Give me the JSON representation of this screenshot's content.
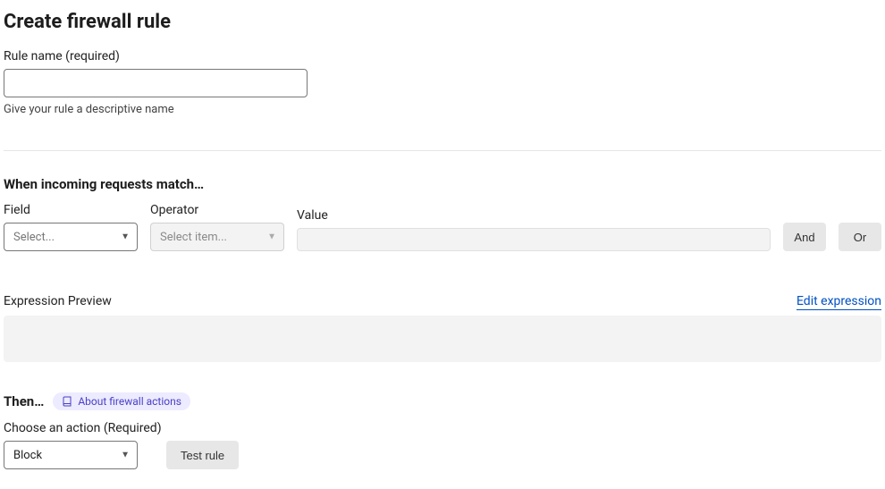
{
  "heading": "Create firewall rule",
  "rule_name": {
    "label": "Rule name (required)",
    "value": "",
    "help": "Give your rule a descriptive name"
  },
  "match": {
    "heading": "When incoming requests match…",
    "field": {
      "label": "Field",
      "placeholder": "Select..."
    },
    "operator": {
      "label": "Operator",
      "placeholder": "Select item..."
    },
    "value": {
      "label": "Value",
      "value": ""
    },
    "and_label": "And",
    "or_label": "Or"
  },
  "preview": {
    "label": "Expression Preview",
    "edit_link": "Edit expression"
  },
  "then": {
    "heading": "Then…",
    "badge": "About firewall actions",
    "action_label": "Choose an action (Required)",
    "action_value": "Block",
    "test_button": "Test rule"
  }
}
